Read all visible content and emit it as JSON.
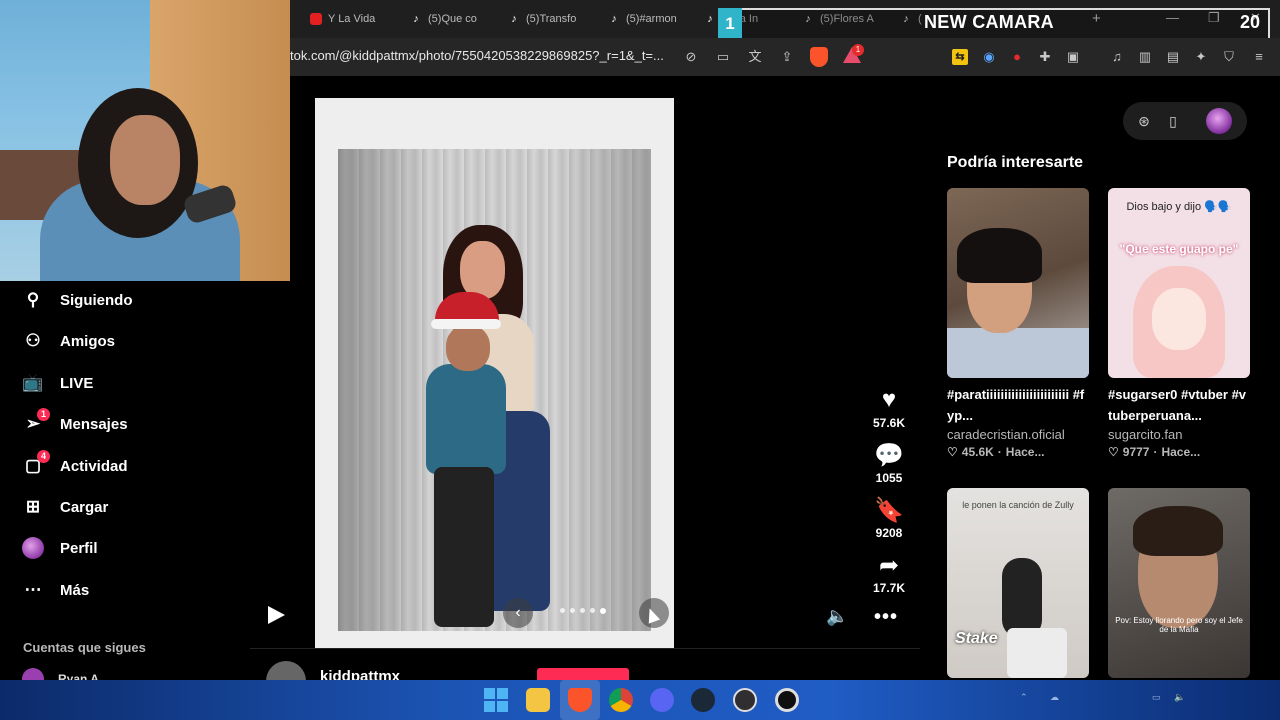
{
  "browser": {
    "tabs": [
      {
        "label": "Y La Vida",
        "icon": "youtube-icon"
      },
      {
        "label": "(5)Que co",
        "icon": "tiktok-icon"
      },
      {
        "label": "(5)Transfo",
        "icon": "tiktok-icon"
      },
      {
        "label": "(5)#armon",
        "icon": "tiktok-icon"
      },
      {
        "label": "Lima In",
        "icon": "tiktok-icon"
      },
      {
        "label": "(5)Flores A",
        "icon": "tiktok-icon"
      },
      {
        "label": "(",
        "icon": "tiktok-icon"
      }
    ],
    "new_tab_symbol": "+",
    "window_controls": {
      "minimize": "—",
      "restore": "❐",
      "close": "✕"
    },
    "url": "tok.com/@kiddpattmx/photo/7550420538229869825?_r=1&_t=..."
  },
  "stream_overlay": {
    "scene_number": "1",
    "title": "NEW CAMARA",
    "counter": "20"
  },
  "sidebar": {
    "items": [
      {
        "label": "Siguiendo",
        "icon": "person-following-icon",
        "badge": ""
      },
      {
        "label": "Amigos",
        "icon": "friends-icon",
        "badge": ""
      },
      {
        "label": "LIVE",
        "icon": "live-tv-icon",
        "badge": ""
      },
      {
        "label": "Mensajes",
        "icon": "messages-icon",
        "badge": "1"
      },
      {
        "label": "Actividad",
        "icon": "activity-inbox-icon",
        "badge": "4"
      },
      {
        "label": "Cargar",
        "icon": "upload-plus-icon",
        "badge": ""
      },
      {
        "label": "Perfil",
        "icon": "profile-avatar",
        "badge": ""
      },
      {
        "label": "Más",
        "icon": "more-dots-icon",
        "badge": ""
      }
    ],
    "following_header": "Cuentas que sigues",
    "following_first": "Ryan A"
  },
  "post": {
    "author": "kiddpattmx",
    "likes": "57.6K",
    "comments": "1055",
    "saves": "9208",
    "shares": "17.7K",
    "more_symbol": "•••"
  },
  "suggestions": {
    "title": "Podría interesarte",
    "items": [
      {
        "desc": "#paratiiiiiiiiiiiiiiiiiiiiiii #fyp...",
        "author": "caradecristian.oficial",
        "likes": "45.6K",
        "time": "Hace..."
      },
      {
        "desc": "#sugarser0 #vtuber #vtuberperuana...",
        "author": "sugarcito.fan",
        "likes": "9777",
        "time": "Hace...",
        "thumb_top": "Dios bajo y dijo 🗣️🗣️",
        "thumb_quote": "\"Que este guapo pe\""
      },
      {
        "thumb_top": "le ponen la canción de Zully",
        "thumb_brand": "Stake"
      },
      {
        "thumb_caption": "Pov: Estoy llorando pero soy el Jefe de la Mafia"
      }
    ]
  },
  "colors": {
    "accent": "#fe2c55",
    "background": "#000000",
    "overlay_accent": "#2fb4c9"
  }
}
